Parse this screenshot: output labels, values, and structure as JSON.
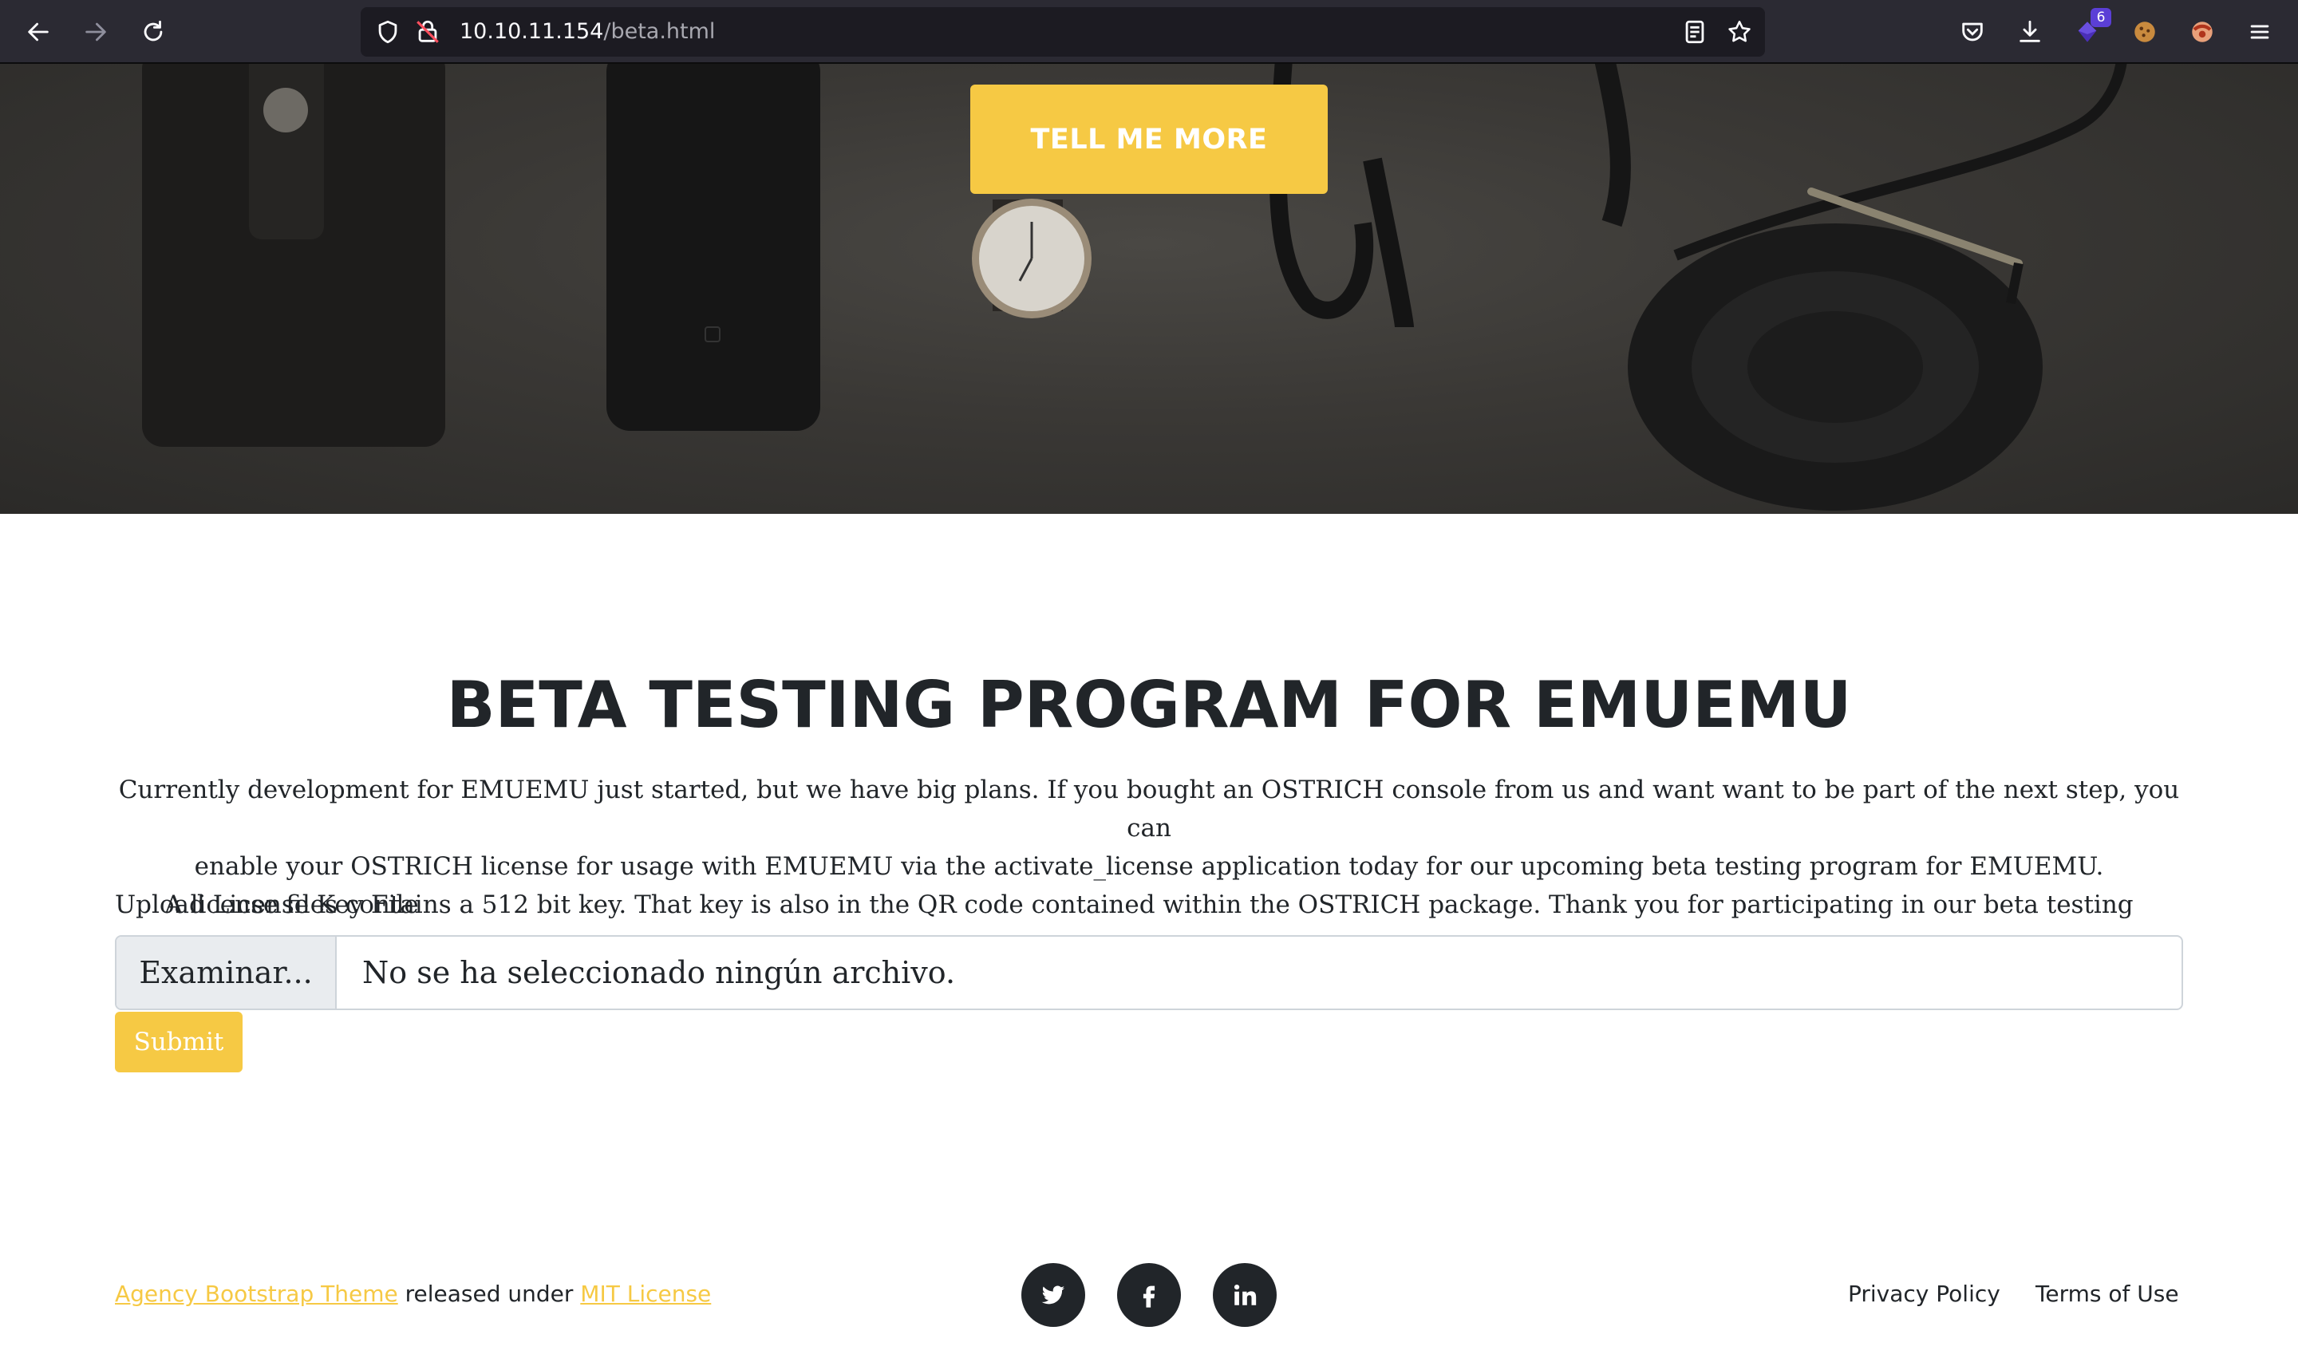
{
  "browser": {
    "url_host": "10.10.11.154",
    "url_path": "/beta.html",
    "extension_badge": "6",
    "icons": [
      "back-icon",
      "forward-icon",
      "reload-icon",
      "shield-icon",
      "insecure-lock-icon",
      "reader-view-icon",
      "bookmark-star-icon",
      "pocket-icon",
      "download-icon",
      "extension-icon",
      "cookie-icon",
      "extension-icon-2",
      "menu-icon"
    ]
  },
  "hero": {
    "button_label": "Tell Me More"
  },
  "main": {
    "title": "BETA TESTING PROGRAM FOR EMUEMU",
    "paragraph_lines": [
      "Currently development for EMUEMU just started, but we have big plans. If you bought an OSTRICH console from us and want want to be part of the next step, you can",
      "enable your OSTRICH license for usage with EMUEMU via the activate_license application today for our upcoming beta testing program for EMUEMU.",
      "A license files contains a 512 bit key. That key is also in the QR code contained within the OSTRICH package. Thank you for participating in our beta testing program."
    ],
    "upload_label": "Upload License Key File",
    "browse_label": "Examinar...",
    "file_status": "No se ha seleccionado ningún archivo.",
    "submit_label": "Submit"
  },
  "footer": {
    "theme_link": "Agency Bootstrap Theme",
    "released_text": " released under ",
    "license_link": "MIT License",
    "social": [
      "twitter-icon",
      "facebook-icon",
      "linkedin-icon"
    ],
    "privacy_link": "Privacy Policy",
    "terms_link": "Terms of Use"
  },
  "colors": {
    "accent": "#f6c944",
    "text": "#212529",
    "toolbar": "#2b2a33"
  }
}
